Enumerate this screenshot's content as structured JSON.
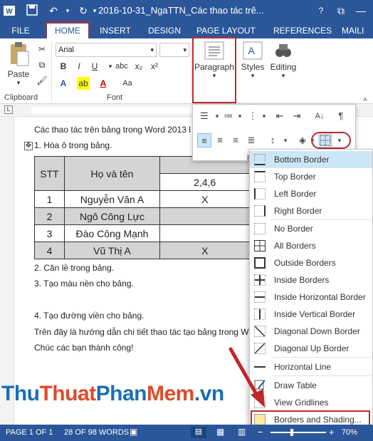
{
  "titlebar": {
    "title": "2016-10-31_NgaTTN_Các thao tác trê...",
    "help": "?",
    "restore": "⧉",
    "minimize": "—"
  },
  "tabs": [
    "FILE",
    "HOME",
    "INSERT",
    "DESIGN",
    "PAGE LAYOUT",
    "REFERENCES",
    "MAILI"
  ],
  "ribbon": {
    "paste_label": "Paste",
    "clipboard_label": "Clipboard",
    "font_name": "Arial",
    "font_label": "Font",
    "paragraph_label": "Paragraph",
    "styles_label": "Styles",
    "editing_label": "Editing",
    "bold": "B",
    "italic": "I",
    "underline": "U",
    "aa": "Aa",
    "A_large": "A",
    "A_small": "A"
  },
  "document": {
    "line1": "Các thao tác trên bảng trong Word 2013 l",
    "line2": "1. Hòa ô trong bảng.",
    "table": {
      "header_stt": "STT",
      "header_name": "Họ và tên",
      "sub_246": "2,4,6",
      "rows": [
        {
          "stt": "1",
          "name": "Nguyễn Văn A",
          "mark": "X"
        },
        {
          "stt": "2",
          "name": "Ngô Công Lực",
          "mark": ""
        },
        {
          "stt": "3",
          "name": "Đào Công Mạnh",
          "mark": ""
        },
        {
          "stt": "4",
          "name": "Vũ Thị A",
          "mark": "X"
        }
      ]
    },
    "line3": "2. Căn lề trong bảng.",
    "line4": "3. Tạo màu nền cho bảng.",
    "line5": "4. Tạo đường viền cho bảng.",
    "line6": "Trên đây là hướng dẫn chi tiết thao tác tạo bảng trong W",
    "line7": "Chúc các bạn thành công!"
  },
  "paragraph_panel_letter": "P",
  "borders_menu": {
    "items": [
      "Bottom Border",
      "Top Border",
      "Left Border",
      "Right Border",
      "No Border",
      "All Borders",
      "Outside Borders",
      "Inside Borders",
      "Inside Horizontal Border",
      "Inside Vertical Border",
      "Diagonal Down Border",
      "Diagonal Up Border",
      "Horizontal Line",
      "Draw Table",
      "View Gridlines",
      "Borders and Shading..."
    ]
  },
  "statusbar": {
    "page": "PAGE 1 OF 1",
    "words": "28 OF 98 WORDS",
    "zoom": "70%"
  },
  "watermark": {
    "part1": "Thu",
    "part2": "Thuat",
    "part3": "Phan",
    "part4": "Mem",
    ".vn": ".vn"
  },
  "colors": {
    "word_blue": "#2b579a",
    "highlight_red": "#c0272d",
    "menu_hover": "#cde6f7"
  }
}
